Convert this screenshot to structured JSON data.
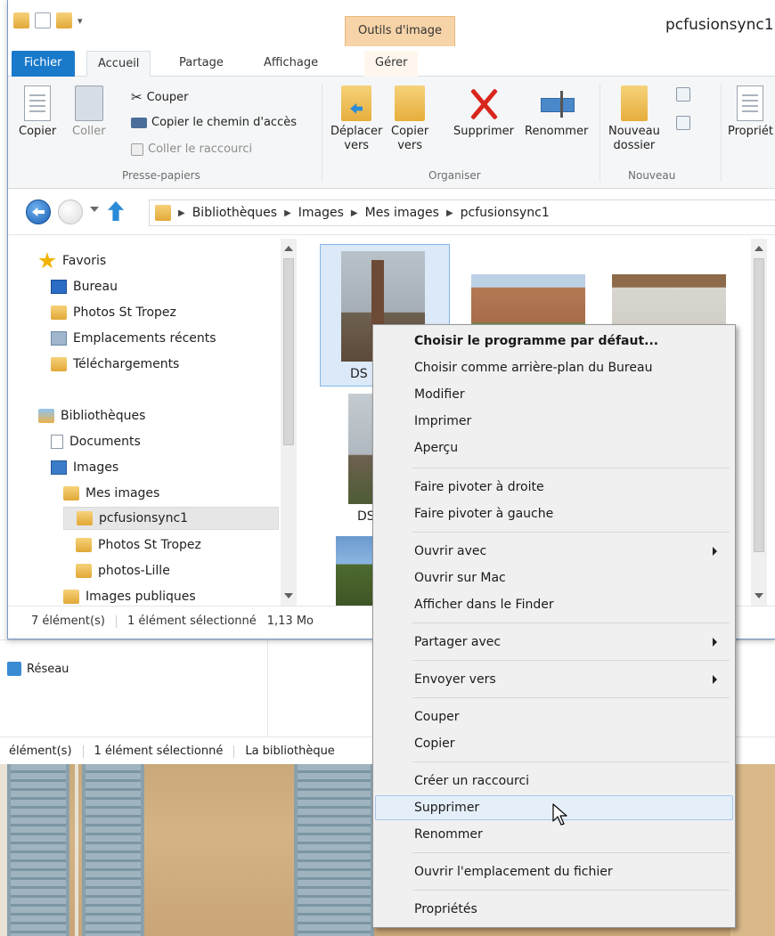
{
  "window": {
    "title": "pcfusionsync1",
    "contextual_tab": "Outils d'image"
  },
  "ribbon_tabs": {
    "fichier": "Fichier",
    "accueil": "Accueil",
    "partage": "Partage",
    "affichage": "Affichage",
    "gerer": "Gérer"
  },
  "ribbon": {
    "clipboard": {
      "copier": "Copier",
      "coller": "Coller",
      "couper": "Couper",
      "copier_chemin": "Copier le chemin d'accès",
      "coller_raccourci": "Coller le raccourci",
      "group_label": "Presse-papiers"
    },
    "organize": {
      "deplacer": "Déplacer",
      "deplacer_2": "vers",
      "copier": "Copier",
      "copier_2": "vers",
      "supprimer": "Supprimer",
      "renommer": "Renommer",
      "group_label": "Organiser"
    },
    "new": {
      "nouveau": "Nouveau",
      "nouveau_2": "dossier",
      "group_label": "Nouveau"
    },
    "open": {
      "proprietes": "Propriét"
    }
  },
  "breadcrumb": [
    "Bibliothèques",
    "Images",
    "Mes images",
    "pcfusionsync1"
  ],
  "nav": {
    "favoris": "Favoris",
    "bureau": "Bureau",
    "photos_st_tropez": "Photos St Tropez",
    "emplacements_recents": "Emplacements récents",
    "telechargements": "Téléchargements",
    "bibliotheques": "Bibliothèques",
    "documents": "Documents",
    "images": "Images",
    "mes_images": "Mes images",
    "pcfusionsync1": "pcfusionsync1",
    "photos_st_tropez_2": "Photos St Tropez",
    "photos_lille": "photos-Lille",
    "images_publiques": "Images publiques"
  },
  "files": [
    {
      "label": "DS"
    },
    {
      "label": ""
    },
    {
      "label": ""
    },
    {
      "label": "DS"
    },
    {
      "label": ""
    }
  ],
  "status": {
    "count": "7 élément(s)",
    "selected": "1 élément sélectionné",
    "size": "1,13 Mo"
  },
  "background_window": {
    "network": "Réseau",
    "count": "élément(s)",
    "selected": "1 élément sélectionné",
    "library": "La bibliothèque"
  },
  "context_menu": [
    {
      "label": "Choisir le programme par défaut...",
      "bold": true
    },
    {
      "label": "Choisir comme arrière-plan du Bureau"
    },
    {
      "label": "Modifier"
    },
    {
      "label": "Imprimer"
    },
    {
      "label": "Aperçu"
    },
    {
      "label": "Faire pivoter à droite"
    },
    {
      "label": "Faire pivoter à gauche"
    },
    {
      "label": "Ouvrir avec",
      "submenu": true
    },
    {
      "label": "Ouvrir sur Mac"
    },
    {
      "label": "Afficher dans le Finder"
    },
    {
      "label": "Partager avec",
      "submenu": true
    },
    {
      "label": "Envoyer vers",
      "submenu": true
    },
    {
      "label": "Couper"
    },
    {
      "label": "Copier"
    },
    {
      "label": "Créer un raccourci"
    },
    {
      "label": "Supprimer",
      "highlighted": true
    },
    {
      "label": "Renommer"
    },
    {
      "label": "Ouvrir l'emplacement du fichier"
    },
    {
      "label": "Propriétés"
    }
  ],
  "colors": {
    "accent": "#1979ca",
    "contextual_tab": "#f7d3a8",
    "highlight": "#e5eff9",
    "delete_red": "#d9261c"
  }
}
